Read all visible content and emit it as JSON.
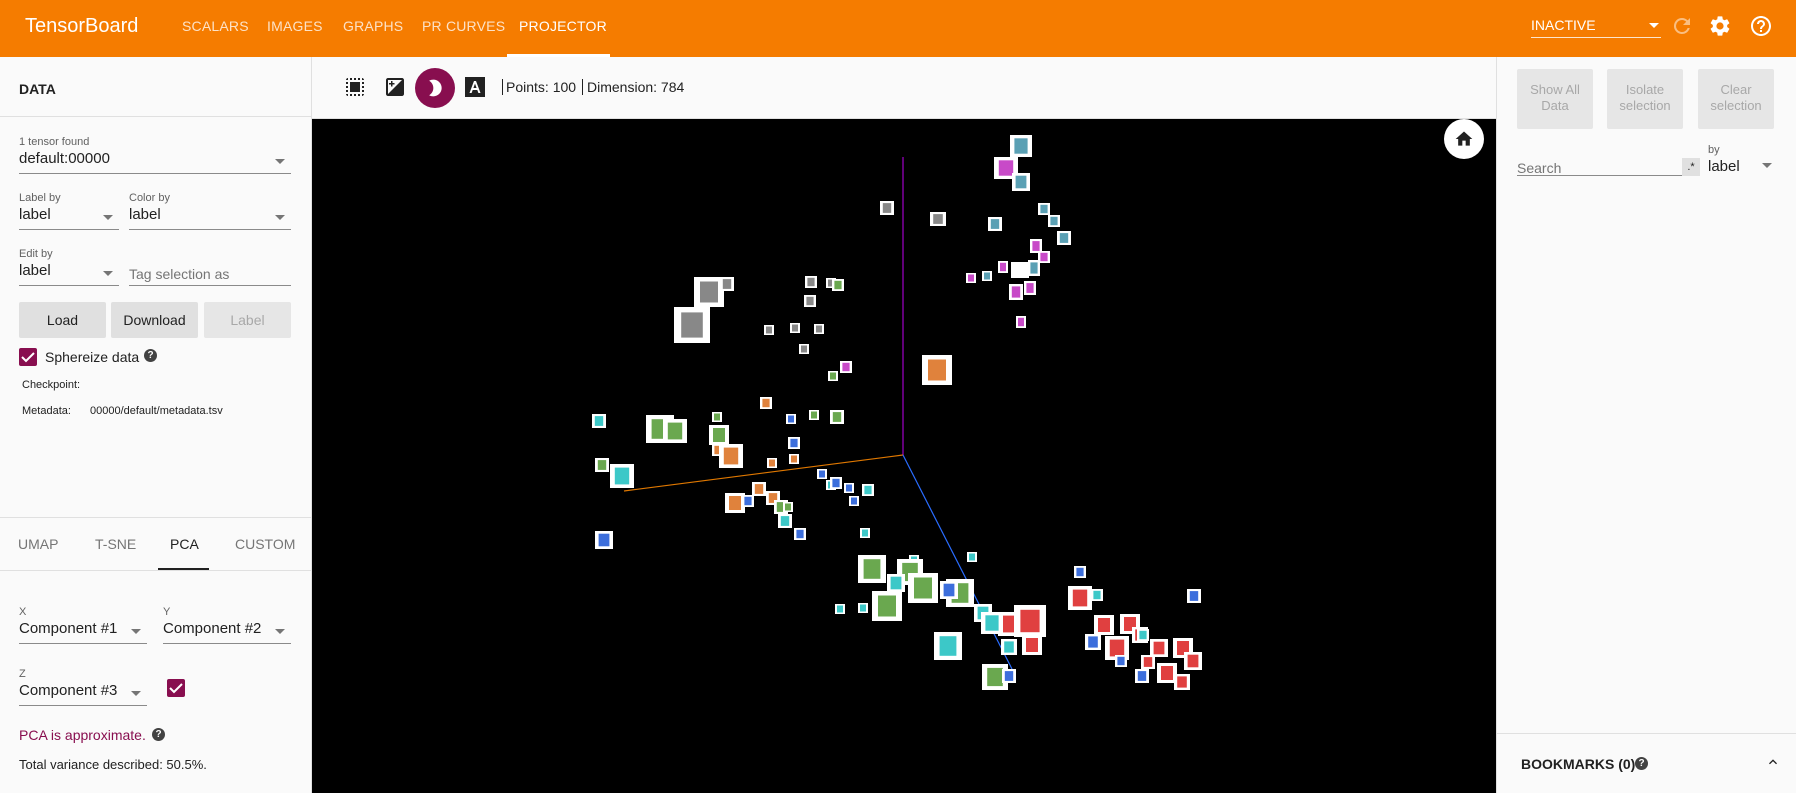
{
  "header": {
    "brand": "TensorBoard",
    "tabs": [
      {
        "label": "SCALARS"
      },
      {
        "label": "IMAGES"
      },
      {
        "label": "GRAPHS"
      },
      {
        "label": "PR CURVES"
      },
      {
        "label": "PROJECTOR"
      }
    ],
    "active_tab": "PROJECTOR",
    "run_select": "INACTIVE",
    "icons": [
      "refresh-icon",
      "settings-icon",
      "help-icon"
    ],
    "accent_color": "#f57c00"
  },
  "data_panel": {
    "title": "DATA",
    "tensor_label": "1 tensor found",
    "tensor_value": "default:00000",
    "label_by_label": "Label by",
    "label_by_value": "label",
    "color_by_label": "Color by",
    "color_by_value": "label",
    "edit_by_label": "Edit by",
    "edit_by_value": "label",
    "tag_placeholder": "Tag selection as",
    "buttons": {
      "load": "Load",
      "download": "Download",
      "label": "Label"
    },
    "sphereize_label": "Sphereize data",
    "sphereize_checked": true,
    "checkpoint_label": "Checkpoint:",
    "checkpoint_value": "",
    "metadata_label": "Metadata:",
    "metadata_value": "00000/default/metadata.tsv"
  },
  "projection": {
    "tabs": [
      {
        "label": "UMAP"
      },
      {
        "label": "T-SNE"
      },
      {
        "label": "PCA"
      },
      {
        "label": "CUSTOM"
      }
    ],
    "active_tab": "PCA",
    "x_label": "X",
    "x_value": "Component #1",
    "y_label": "Y",
    "y_value": "Component #2",
    "z_label": "Z",
    "z_value": "Component #3",
    "z_enabled": true,
    "approx_note": "PCA is approximate.",
    "variance_text": "Total variance described: 50.5%."
  },
  "toolbar": {
    "icons": [
      "select-rectangle-icon",
      "edit-image-icon",
      "night-mode-icon",
      "label-toggle-icon"
    ],
    "points_text": "Points: 100",
    "dimension_text": "Dimension: 784"
  },
  "right_panel": {
    "show_all": "Show All Data",
    "isolate": "Isolate selection",
    "clear": "Clear selection",
    "search_placeholder": "Search",
    "regex_label": ".*",
    "by_label": "by",
    "by_value": "label",
    "bookmarks_title": "BOOKMARKS (0)"
  }
}
